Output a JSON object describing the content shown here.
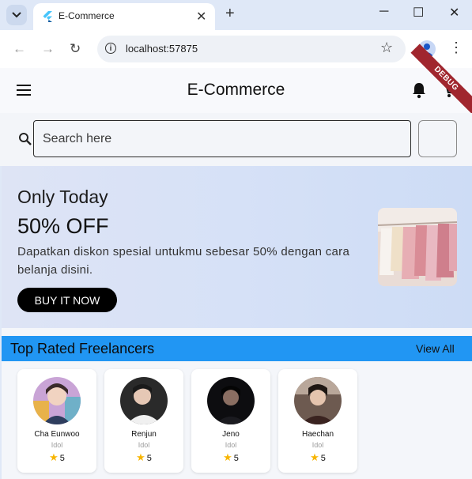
{
  "browser": {
    "tab_title": "E-Commerce",
    "tab_close": "✕",
    "new_tab": "+",
    "url": "localhost:57875",
    "window_controls": [
      "─",
      "☐",
      "✕"
    ]
  },
  "app": {
    "title": "E-Commerce",
    "debug_label": "DEBUG",
    "search_placeholder": "Search here"
  },
  "banner": {
    "kicker": "Only Today",
    "offer": "50% OFF",
    "description": "Dapatkan diskon spesial untukmu sebesar 50% dengan cara belanja disini.",
    "button_label": "BUY IT NOW"
  },
  "section": {
    "title": "Top Rated Freelancers",
    "link_label": "View All"
  },
  "freelancers": [
    {
      "name": "Cha Eunwoo",
      "role": "Idol",
      "rating": "5"
    },
    {
      "name": "Renjun",
      "role": "Idol",
      "rating": "5"
    },
    {
      "name": "Jeno",
      "role": "Idol",
      "rating": "5"
    },
    {
      "name": "Haechan",
      "role": "Idol",
      "rating": "5"
    }
  ],
  "colors": {
    "section_bar": "#2196f3",
    "star": "#f7b500",
    "debug_ribbon": "#a0262e"
  }
}
